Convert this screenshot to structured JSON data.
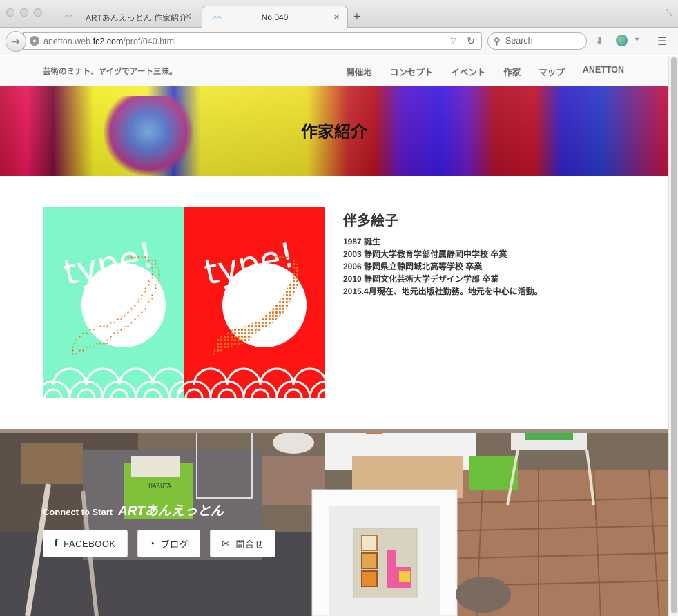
{
  "browser": {
    "tabs": [
      {
        "title": "ARTあんえっとん:作家紹介",
        "active": false
      },
      {
        "title": "No.040",
        "active": true
      }
    ],
    "url_prefix": "anetton.web.",
    "url_domain": "fc2.com",
    "url_path": "/prof/040.html",
    "search_placeholder": "Search"
  },
  "site": {
    "brand": "芸術のミナト、ヤイヅでアート三昧。",
    "nav": [
      "開催地",
      "コンセプト",
      "イベント",
      "作家",
      "マップ",
      "ANETTON"
    ],
    "hero_title": "作家紹介"
  },
  "artwork": {
    "left_text": "type!",
    "right_text": "type!",
    "left_bg": "#7ff7c9",
    "right_bg": "#ff1414",
    "accent": "#e8761e"
  },
  "artist": {
    "name": "伴多絵子",
    "bio": [
      "1987 誕生",
      "2003 静岡大学教育学部付属静岡中学校 卒業",
      "2006 静岡県立静岡城北高等学校 卒業",
      "2010 静岡文化芸術大学デザイン学部 卒業",
      "2015.4月現在、地元出版社勤務。地元を中心に活動。"
    ]
  },
  "footer": {
    "connect_small": "Connect to Start",
    "connect_big": "ARTあんえっとん",
    "buttons": [
      {
        "icon": "facebook-icon",
        "label": "FACEBOOK"
      },
      {
        "icon": "rss-icon",
        "label": "ブログ"
      },
      {
        "icon": "mail-icon",
        "label": "問合せ"
      }
    ],
    "box_label": "HARUTA"
  }
}
